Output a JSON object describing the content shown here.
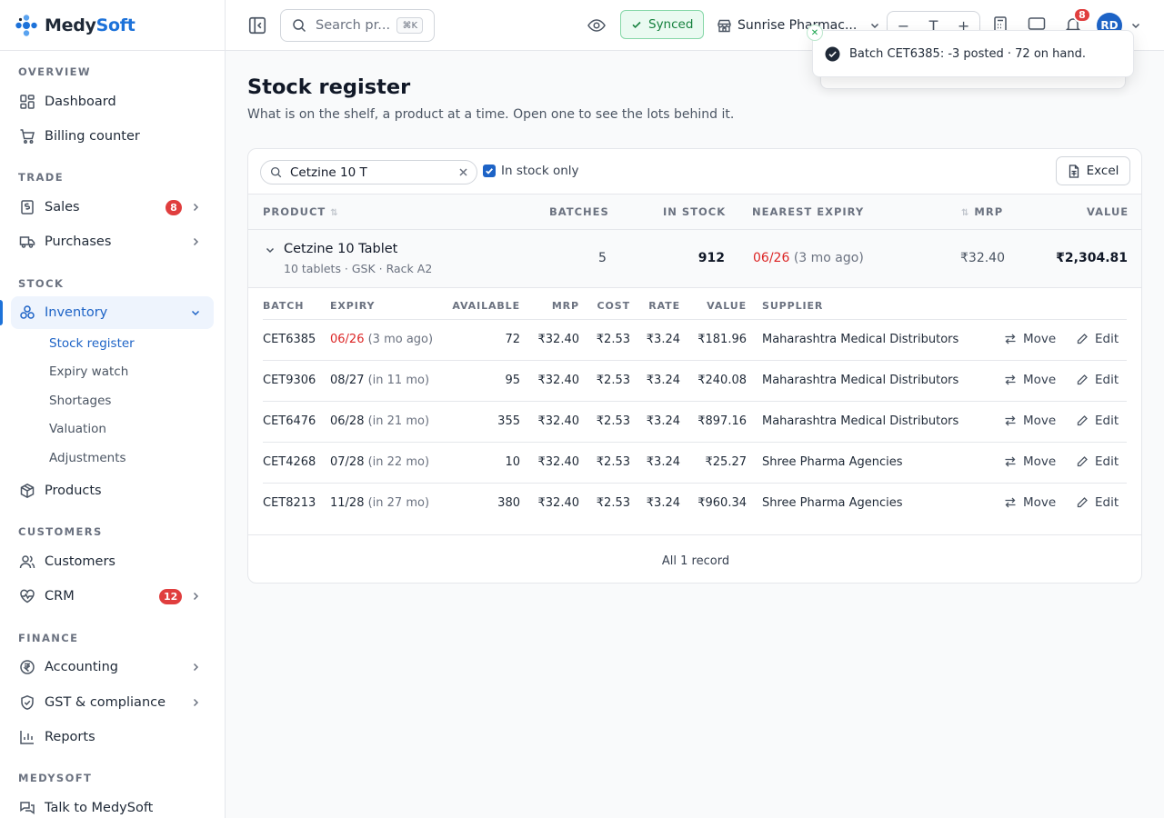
{
  "app": {
    "brand_part1": "Medy",
    "brand_part2": "Soft"
  },
  "colors": {
    "accent": "#1d72d9",
    "danger": "#dc2626",
    "success": "#15803d"
  },
  "sidebar": {
    "sections": {
      "overview": "OVERVIEW",
      "trade": "TRADE",
      "stock": "STOCK",
      "customers": "CUSTOMERS",
      "finance": "FINANCE",
      "medysoft": "MEDYSOFT"
    },
    "items": {
      "dashboard": "Dashboard",
      "billing": "Billing counter",
      "sales": "Sales",
      "sales_badge": "8",
      "purchases": "Purchases",
      "inventory": "Inventory",
      "products": "Products",
      "customers": "Customers",
      "crm": "CRM",
      "crm_badge": "12",
      "accounting": "Accounting",
      "gst": "GST & compliance",
      "reports": "Reports",
      "talk": "Talk to MedySoft"
    },
    "inventory_sub": {
      "stock_register": "Stock register",
      "expiry_watch": "Expiry watch",
      "shortages": "Shortages",
      "valuation": "Valuation",
      "adjustments": "Adjustments"
    }
  },
  "topbar": {
    "search_placeholder": "Search pr...",
    "search_kbd": "⌘K",
    "synced": "Synced",
    "store": "Sunrise Pharmac...",
    "zoom_minus": "−",
    "zoom_font": "T",
    "zoom_plus": "+",
    "notif_count": "8",
    "avatar": "RD"
  },
  "toast": {
    "message": "Batch CET6385: -3 posted · 72 on hand."
  },
  "page": {
    "title": "Stock register",
    "subtitle": "What is on the shelf, a product at a time. Open one to see the lots behind it."
  },
  "filter": {
    "search_value": "Cetzine 10 T",
    "in_stock_only": "In stock only",
    "excel": "Excel"
  },
  "table": {
    "headers": {
      "product": "PRODUCT",
      "batches": "BATCHES",
      "in_stock": "IN STOCK",
      "nearest_expiry": "NEAREST EXPIRY",
      "mrp": "MRP",
      "value": "VALUE"
    },
    "product": {
      "name": "Cetzine 10 Tablet",
      "meta": "10 tablets · GSK · Rack A2",
      "batches": "5",
      "in_stock": "912",
      "expiry": "06/26",
      "expiry_rel": "(3 mo ago)",
      "mrp": "₹32.40",
      "value": "₹2,304.81"
    },
    "batch_headers": {
      "batch": "BATCH",
      "expiry": "EXPIRY",
      "available": "AVAILABLE",
      "mrp": "MRP",
      "cost": "COST",
      "rate": "RATE",
      "value": "VALUE",
      "supplier": "SUPPLIER"
    },
    "batches": [
      {
        "batch": "CET6385",
        "expiry": "06/26",
        "expiry_rel": "(3 mo ago)",
        "expired": true,
        "available": "72",
        "mrp": "₹32.40",
        "cost": "₹2.53",
        "rate": "₹3.24",
        "value": "₹181.96",
        "supplier": "Maharashtra Medical Distributors"
      },
      {
        "batch": "CET9306",
        "expiry": "08/27",
        "expiry_rel": "(in 11 mo)",
        "expired": false,
        "available": "95",
        "mrp": "₹32.40",
        "cost": "₹2.53",
        "rate": "₹3.24",
        "value": "₹240.08",
        "supplier": "Maharashtra Medical Distributors"
      },
      {
        "batch": "CET6476",
        "expiry": "06/28",
        "expiry_rel": "(in 21 mo)",
        "expired": false,
        "available": "355",
        "mrp": "₹32.40",
        "cost": "₹2.53",
        "rate": "₹3.24",
        "value": "₹897.16",
        "supplier": "Maharashtra Medical Distributors"
      },
      {
        "batch": "CET4268",
        "expiry": "07/28",
        "expiry_rel": "(in 22 mo)",
        "expired": false,
        "available": "10",
        "mrp": "₹32.40",
        "cost": "₹2.53",
        "rate": "₹3.24",
        "value": "₹25.27",
        "supplier": "Shree Pharma Agencies"
      },
      {
        "batch": "CET8213",
        "expiry": "11/28",
        "expiry_rel": "(in 27 mo)",
        "expired": false,
        "available": "380",
        "mrp": "₹32.40",
        "cost": "₹2.53",
        "rate": "₹3.24",
        "value": "₹960.34",
        "supplier": "Shree Pharma Agencies"
      }
    ],
    "actions": {
      "move": "Move",
      "edit": "Edit"
    },
    "footer": "All 1 record"
  }
}
